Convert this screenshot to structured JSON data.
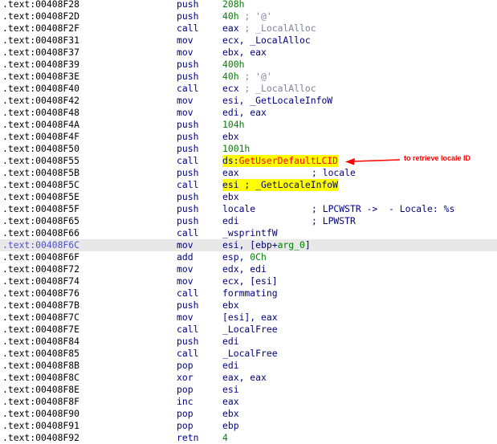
{
  "lines": [
    {
      "addr": ".text:00408F28",
      "mn": "push",
      "ops": [
        {
          "t": "208h",
          "c": "num"
        }
      ]
    },
    {
      "addr": ".text:00408F2D",
      "mn": "push",
      "ops": [
        {
          "t": "40h",
          "c": "num"
        },
        {
          "t": " ; '@'",
          "c": "cmt"
        }
      ]
    },
    {
      "addr": ".text:00408F2F",
      "mn": "call",
      "ops": [
        {
          "t": "eax",
          "c": "reg"
        },
        {
          "t": " ; _LocalAlloc",
          "c": "cmt"
        }
      ]
    },
    {
      "addr": ".text:00408F31",
      "mn": "mov",
      "ops": [
        {
          "t": "ecx, _LocalAlloc",
          "c": "sym"
        }
      ]
    },
    {
      "addr": ".text:00408F37",
      "mn": "mov",
      "ops": [
        {
          "t": "ebx, eax",
          "c": "reg"
        }
      ]
    },
    {
      "addr": ".text:00408F39",
      "mn": "push",
      "ops": [
        {
          "t": "400h",
          "c": "num"
        }
      ]
    },
    {
      "addr": ".text:00408F3E",
      "mn": "push",
      "ops": [
        {
          "t": "40h",
          "c": "num"
        },
        {
          "t": " ; '@'",
          "c": "cmt"
        }
      ]
    },
    {
      "addr": ".text:00408F40",
      "mn": "call",
      "ops": [
        {
          "t": "ecx",
          "c": "reg"
        },
        {
          "t": " ; _LocalAlloc",
          "c": "cmt"
        }
      ]
    },
    {
      "addr": ".text:00408F42",
      "mn": "mov",
      "ops": [
        {
          "t": "esi, _GetLocaleInfoW",
          "c": "sym"
        }
      ]
    },
    {
      "addr": ".text:00408F48",
      "mn": "mov",
      "ops": [
        {
          "t": "edi, eax",
          "c": "reg"
        }
      ]
    },
    {
      "addr": ".text:00408F4A",
      "mn": "push",
      "ops": [
        {
          "t": "104h",
          "c": "num"
        }
      ]
    },
    {
      "addr": ".text:00408F4F",
      "mn": "push",
      "ops": [
        {
          "t": "ebx",
          "c": "reg"
        }
      ]
    },
    {
      "addr": ".text:00408F50",
      "mn": "push",
      "ops": [
        {
          "t": "1001h",
          "c": "num"
        }
      ]
    },
    {
      "addr": ".text:00408F55",
      "mn": "call",
      "yl": true,
      "ops": [
        {
          "t": "ds:",
          "c": "reg"
        },
        {
          "t": "GetUserDefaultLCID",
          "c": "red"
        }
      ]
    },
    {
      "addr": ".text:00408F5B",
      "mn": "push",
      "ops": [
        {
          "t": "eax",
          "c": "reg"
        }
      ],
      "cmt": "; locale"
    },
    {
      "addr": ".text:00408F5C",
      "mn": "call",
      "yl": true,
      "ops": [
        {
          "t": "esi",
          "c": "reg"
        },
        {
          "t": " ; _GetLocaleInfoW",
          "c": "sym"
        }
      ]
    },
    {
      "addr": ".text:00408F5E",
      "mn": "push",
      "ops": [
        {
          "t": "ebx",
          "c": "reg"
        }
      ]
    },
    {
      "addr": ".text:00408F5F",
      "mn": "push",
      "ops": [
        {
          "t": "locale",
          "c": "sym"
        }
      ],
      "cmt": "; LPCWSTR ->  - Locale: %s"
    },
    {
      "addr": ".text:00408F65",
      "mn": "push",
      "ops": [
        {
          "t": "edi",
          "c": "reg"
        }
      ],
      "cmt": "; LPWSTR"
    },
    {
      "addr": ".text:00408F66",
      "mn": "call",
      "ops": [
        {
          "t": "_wsprintfW",
          "c": "sym"
        }
      ]
    },
    {
      "addr": ".text:00408F6C",
      "mn": "mov",
      "hl": true,
      "ops": [
        {
          "t": "esi, [ebp+",
          "c": "reg"
        },
        {
          "t": "arg_0",
          "c": "num"
        },
        {
          "t": "]",
          "c": "reg"
        }
      ]
    },
    {
      "addr": ".text:00408F6F",
      "mn": "add",
      "ops": [
        {
          "t": "esp, ",
          "c": "reg"
        },
        {
          "t": "0Ch",
          "c": "num"
        }
      ]
    },
    {
      "addr": ".text:00408F72",
      "mn": "mov",
      "ops": [
        {
          "t": "edx, edi",
          "c": "reg"
        }
      ]
    },
    {
      "addr": ".text:00408F74",
      "mn": "mov",
      "ops": [
        {
          "t": "ecx, [esi]",
          "c": "reg"
        }
      ]
    },
    {
      "addr": ".text:00408F76",
      "mn": "call",
      "ops": [
        {
          "t": "formmating",
          "c": "sym"
        }
      ]
    },
    {
      "addr": ".text:00408F7B",
      "mn": "push",
      "ops": [
        {
          "t": "ebx",
          "c": "reg"
        }
      ]
    },
    {
      "addr": ".text:00408F7C",
      "mn": "mov",
      "ops": [
        {
          "t": "[esi], eax",
          "c": "reg"
        }
      ]
    },
    {
      "addr": ".text:00408F7E",
      "mn": "call",
      "ops": [
        {
          "t": "_LocalFree",
          "c": "sym"
        }
      ]
    },
    {
      "addr": ".text:00408F84",
      "mn": "push",
      "ops": [
        {
          "t": "edi",
          "c": "reg"
        }
      ]
    },
    {
      "addr": ".text:00408F85",
      "mn": "call",
      "ops": [
        {
          "t": "_LocalFree",
          "c": "sym"
        }
      ]
    },
    {
      "addr": ".text:00408F8B",
      "mn": "pop",
      "ops": [
        {
          "t": "edi",
          "c": "reg"
        }
      ]
    },
    {
      "addr": ".text:00408F8C",
      "mn": "xor",
      "ops": [
        {
          "t": "eax, eax",
          "c": "reg"
        }
      ]
    },
    {
      "addr": ".text:00408F8E",
      "mn": "pop",
      "ops": [
        {
          "t": "esi",
          "c": "reg"
        }
      ]
    },
    {
      "addr": ".text:00408F8F",
      "mn": "inc",
      "ops": [
        {
          "t": "eax",
          "c": "reg"
        }
      ]
    },
    {
      "addr": ".text:00408F90",
      "mn": "pop",
      "ops": [
        {
          "t": "ebx",
          "c": "reg"
        }
      ]
    },
    {
      "addr": ".text:00408F91",
      "mn": "pop",
      "ops": [
        {
          "t": "ebp",
          "c": "reg"
        }
      ]
    },
    {
      "addr": ".text:00408F92",
      "mn": "retn",
      "ops": [
        {
          "t": "4",
          "c": "num"
        }
      ]
    }
  ],
  "annotation": {
    "text": "to retrieve locale ID",
    "arrow_icon": "red-arrow-left-icon",
    "color": "#ff0000"
  },
  "colors": {
    "highlight_yellow": "#ffff00",
    "current_line": "#e8e8e8",
    "mnemonic": "#000080",
    "number": "#008000",
    "api_name": "#ff0000"
  }
}
